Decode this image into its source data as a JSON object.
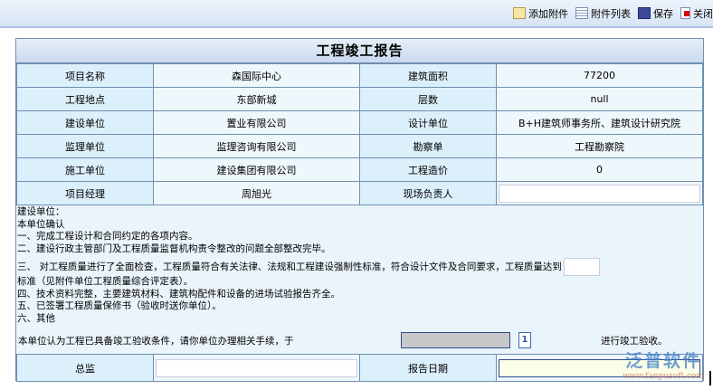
{
  "toolbar": {
    "add_attachment": "添加附件",
    "attachment_list": "附件列表",
    "save": "保存",
    "close": "关闭"
  },
  "report": {
    "title": "工程竣工报告",
    "rows": [
      {
        "l1": "项目名称",
        "v1": "森国际中心",
        "l2": "建筑面积",
        "v2": "77200"
      },
      {
        "l1": "工程地点",
        "v1": "东部新城",
        "l2": "层数",
        "v2": "null"
      },
      {
        "l1": "建设单位",
        "v1": "置业有限公司",
        "l2": "设计单位",
        "v2": "B+H建筑师事务所、建筑设计研究院"
      },
      {
        "l1": "监理单位",
        "v1": "监理咨询有限公司",
        "l2": "勘察单",
        "v2": "工程勘察院"
      },
      {
        "l1": "施工单位",
        "v1": "建设集团有限公司",
        "l2": "工程造价",
        "v2": "0"
      }
    ],
    "manager_label": "项目经理",
    "manager_value": "周旭光",
    "site_lead_label": "现场负责人",
    "site_lead_value": ""
  },
  "statement": {
    "l0": "建设单位：",
    "l1": "本单位确认",
    "l2": "一、完成工程设计和合同约定的各项内容。",
    "l3": "二、建设行政主管部门及工程质量监督机构责令整改的问题全部整改完毕。",
    "l4": "三、  对工程质量进行了全面检查，工程质量符合有关法律、法规和工程建设强制性标准，符合设计文件及合同要求，工程质量达到",
    "l5": "标准（见附件单位工程质量综合评定表）。",
    "l6": "四、技术资料完整，主要建筑材料、建筑构配件和设备的进场试验报告齐全。",
    "l7": "五、已签署工程质量保修书（验收时送你单位）。",
    "l8": "六、其他",
    "request": "本单位认为工程已具备竣工验收条件，请你单位办理相关手续，于",
    "request_end": "进行竣工验收。",
    "calendar_glyph": "1"
  },
  "footer": {
    "supervisor_label": "总监",
    "report_date_label": "报告日期"
  },
  "watermark": {
    "name": "泛普软件",
    "url": "www.fanpusoft.com"
  }
}
